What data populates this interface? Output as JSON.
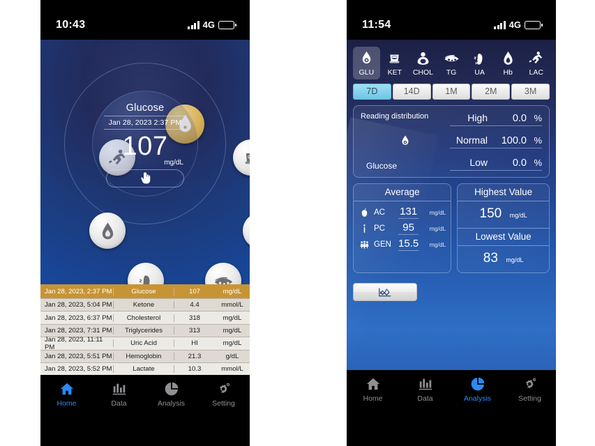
{
  "left": {
    "status": {
      "time": "10:43",
      "network": "4G"
    },
    "reading": {
      "title": "Glucose",
      "datetime": "Jan 28, 2023 2:37 PM",
      "value": "107",
      "unit": "mg/dL",
      "test_icon": "finger-prick-icon"
    },
    "ring_icons": [
      {
        "name": "glucose-icon",
        "label": "Glucose",
        "active": true
      },
      {
        "name": "ketone-icon",
        "label": "Ketone",
        "active": false
      },
      {
        "name": "cholesterol-icon",
        "label": "Cholesterol",
        "active": false
      },
      {
        "name": "triglycerides-icon",
        "label": "Triglycerides",
        "active": false
      },
      {
        "name": "uric-acid-icon",
        "label": "Uric Acid",
        "active": false
      },
      {
        "name": "hemoglobin-icon",
        "label": "Hemoglobin",
        "active": false
      },
      {
        "name": "lactate-icon",
        "label": "Lactate",
        "active": false
      }
    ],
    "table": {
      "rows": [
        {
          "time": "Jan 28, 2023, 2:37 PM",
          "name": "Glucose",
          "value": "107",
          "unit": "mg/dL",
          "highlighted": true
        },
        {
          "time": "Jan 28, 2023, 5:04 PM",
          "name": "Ketone",
          "value": "4.4",
          "unit": "mmol/L",
          "highlighted": false
        },
        {
          "time": "Jan 28, 2023, 6:37 PM",
          "name": "Cholesterol",
          "value": "318",
          "unit": "mg/dL",
          "highlighted": false
        },
        {
          "time": "Jan 28, 2023, 7:31 PM",
          "name": "Triglycerides",
          "value": "313",
          "unit": "mg/dL",
          "highlighted": false
        },
        {
          "time": "Jan 28, 2023, 11:11 PM",
          "name": "Uric Acid",
          "value": "HI",
          "unit": "mg/dL",
          "highlighted": false
        },
        {
          "time": "Jan 28, 2023, 5:51 PM",
          "name": "Hemoglobin",
          "value": "21.3",
          "unit": "g/dL",
          "highlighted": false
        },
        {
          "time": "Jan 28, 2023, 5:52 PM",
          "name": "Lactate",
          "value": "10.3",
          "unit": "mmol/L",
          "highlighted": false
        }
      ]
    },
    "nav": [
      {
        "label": "Home",
        "icon": "home-icon",
        "active": true
      },
      {
        "label": "Data",
        "icon": "bar-chart-icon",
        "active": false
      },
      {
        "label": "Analysis",
        "icon": "pie-chart-icon",
        "active": false
      },
      {
        "label": "Setting",
        "icon": "gear-icon",
        "active": false
      }
    ]
  },
  "right": {
    "status": {
      "time": "11:54",
      "network": "4G"
    },
    "analytes": [
      {
        "label": "GLU",
        "icon": "glucose-icon",
        "selected": true
      },
      {
        "label": "KET",
        "icon": "ketone-icon",
        "selected": false
      },
      {
        "label": "CHOL",
        "icon": "cholesterol-icon",
        "selected": false
      },
      {
        "label": "TG",
        "icon": "triglycerides-icon",
        "selected": false
      },
      {
        "label": "UA",
        "icon": "uric-acid-icon",
        "selected": false
      },
      {
        "label": "Hb",
        "icon": "hemoglobin-icon",
        "selected": false
      },
      {
        "label": "LAC",
        "icon": "lactate-icon",
        "selected": false
      }
    ],
    "ranges": [
      {
        "label": "7D",
        "selected": true
      },
      {
        "label": "14D",
        "selected": false
      },
      {
        "label": "1M",
        "selected": false
      },
      {
        "label": "2M",
        "selected": false
      },
      {
        "label": "3M",
        "selected": false
      }
    ],
    "distribution": {
      "title": "Reading distribution",
      "analyte": "Glucose",
      "icon": "glucose-icon",
      "rows": [
        {
          "label": "High",
          "value": "0.0",
          "pct": "%"
        },
        {
          "label": "Normal",
          "value": "100.0",
          "pct": "%"
        },
        {
          "label": "Low",
          "value": "0.0",
          "pct": "%"
        }
      ]
    },
    "average": {
      "title": "Average",
      "rows": [
        {
          "icon": "apple-icon",
          "label": "AC",
          "value": "131",
          "unit": "mg/dL"
        },
        {
          "icon": "fork-icon",
          "label": "PC",
          "value": "95",
          "unit": "mg/dL"
        },
        {
          "icon": "people-icon",
          "label": "GEN",
          "value": "15.5",
          "unit": "mg/dL"
        }
      ]
    },
    "highest": {
      "title": "Highest Value",
      "value": "150",
      "unit": "mg/dL"
    },
    "lowest": {
      "title": "Lowest Value",
      "value": "83",
      "unit": "mg/dL"
    },
    "chart_button": {
      "icon": "line-chart-icon"
    },
    "nav": [
      {
        "label": "Home",
        "icon": "home-icon",
        "active": false
      },
      {
        "label": "Data",
        "icon": "bar-chart-icon",
        "active": false
      },
      {
        "label": "Analysis",
        "icon": "pie-chart-icon",
        "active": true
      },
      {
        "label": "Setting",
        "icon": "gear-icon",
        "active": false
      }
    ]
  },
  "chart_data": {
    "type": "pie",
    "title": "Reading distribution",
    "categories": [
      "High",
      "Normal",
      "Low"
    ],
    "values": [
      0.0,
      100.0,
      0.0
    ],
    "unit": "%",
    "analyte": "Glucose",
    "period": "7D",
    "summary": {
      "average_ac": 131,
      "average_pc": 95,
      "average_gen": 15.5,
      "highest": 150,
      "lowest": 83,
      "value_unit": "mg/dL"
    },
    "xlabel": "",
    "ylabel": "",
    "legend": "right"
  }
}
